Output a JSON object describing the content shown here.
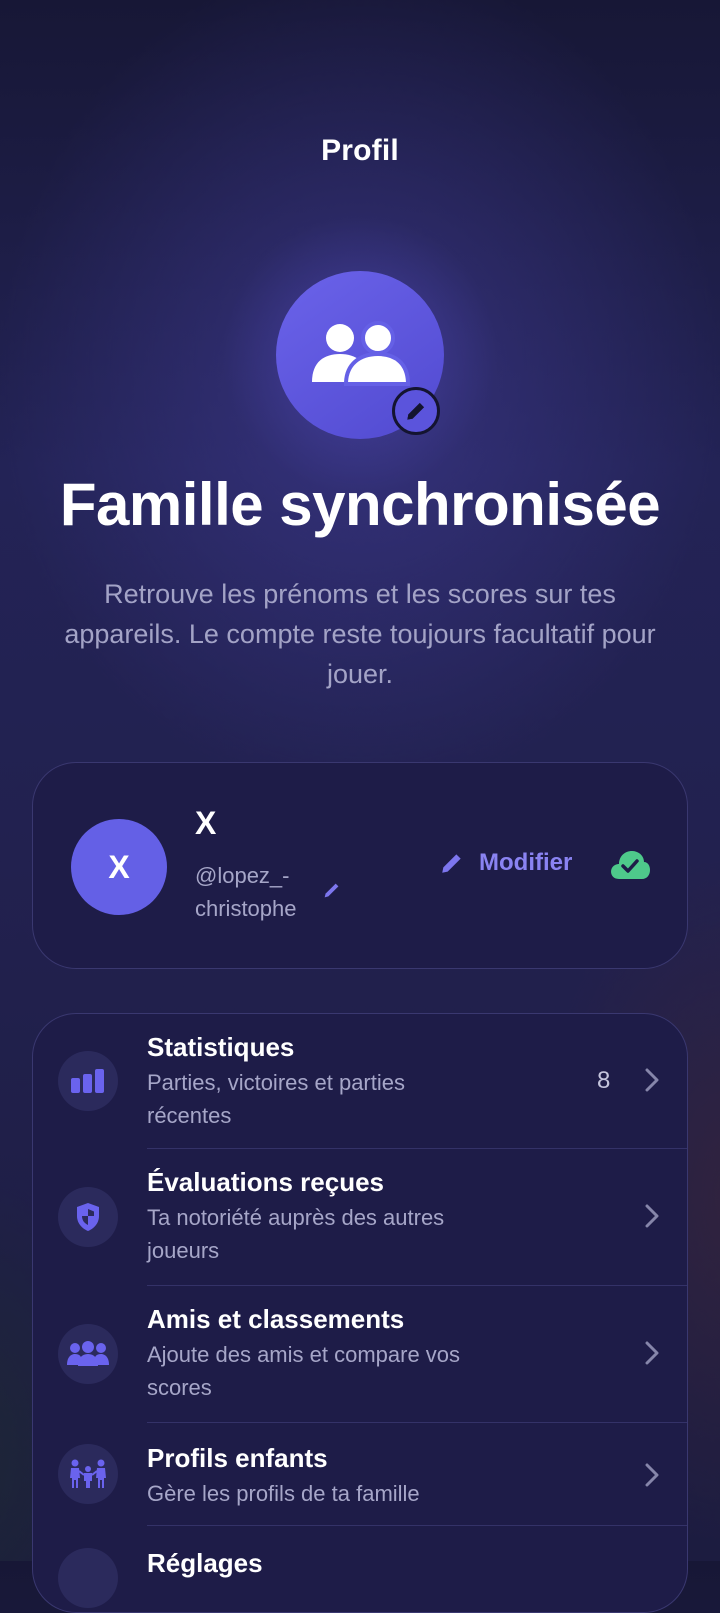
{
  "header": {
    "title": "Profil"
  },
  "hero": {
    "title": "Famille synchronisée",
    "subtitle": "Retrouve les prénoms et les scores sur tes appareils. Le compte reste toujours facultatif pour jouer."
  },
  "account": {
    "avatar_letter": "X",
    "name": "X",
    "handle": "@lopez_-christophe",
    "modify_label": "Modifier"
  },
  "menu": {
    "items": [
      {
        "title": "Statistiques",
        "subtitle": "Parties, victoires et parties récentes",
        "count": "8",
        "icon": "bar-chart-icon"
      },
      {
        "title": "Évaluations reçues",
        "subtitle": "Ta notoriété auprès des autres joueurs",
        "icon": "shield-icon"
      },
      {
        "title": "Amis et classements",
        "subtitle": "Ajoute des amis et compare vos scores",
        "icon": "group-icon"
      },
      {
        "title": "Profils enfants",
        "subtitle": "Gère les profils de ta famille",
        "icon": "family-icon"
      },
      {
        "title": "Réglages",
        "subtitle": "",
        "icon": "gear-icon"
      }
    ]
  },
  "colors": {
    "accent": "#6460e6",
    "cloud_ok": "#4ec98b",
    "card": "#1e1c48"
  }
}
